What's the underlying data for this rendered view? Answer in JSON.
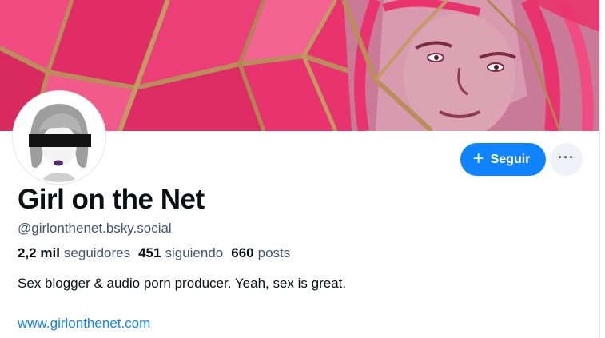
{
  "profile": {
    "display_name": "Girl on the Net",
    "handle": "@girlonthenet.bsky.social",
    "bio": "Sex blogger & audio porn producer. Yeah, sex is great.",
    "website": "www.girlonthenet.com"
  },
  "stats": {
    "followers_value": "2,2 mil",
    "followers_label": "seguidores",
    "following_value": "451",
    "following_label": "siguiendo",
    "posts_value": "660",
    "posts_label": "posts"
  },
  "actions": {
    "follow_label": "Seguir",
    "follow_icon": "plus-icon",
    "more_icon": "ellipsis-icon"
  },
  "colors": {
    "accent": "#1083fe",
    "banner_pink": "#e8336e"
  }
}
